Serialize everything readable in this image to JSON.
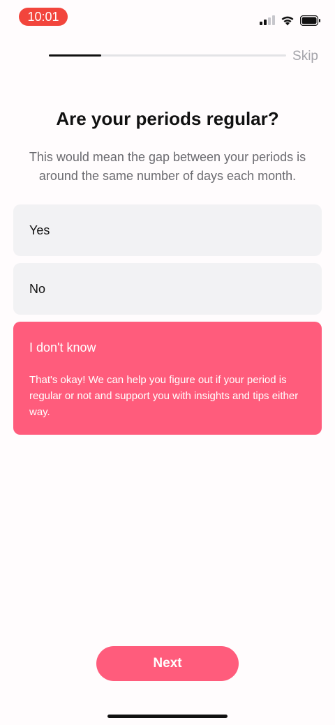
{
  "status_bar": {
    "time": "10:01",
    "time_pill_color": "#f2453c",
    "icons": [
      "cellular-signal-icon",
      "wifi-icon",
      "battery-icon"
    ]
  },
  "header": {
    "progress_fraction": 0.22,
    "skip_label": "Skip"
  },
  "question": {
    "title": "Are your periods regular?",
    "subtitle": "This would mean the gap between your periods is around the same number of days each month."
  },
  "options": [
    {
      "label": "Yes",
      "selected": false
    },
    {
      "label": "No",
      "selected": false
    },
    {
      "label": "I don't know",
      "selected": true,
      "description": "That's okay! We can help you figure out if your period is regular or not and support you with insights and tips either way."
    }
  ],
  "next_label": "Next",
  "accent_color": "#ff5c7c"
}
